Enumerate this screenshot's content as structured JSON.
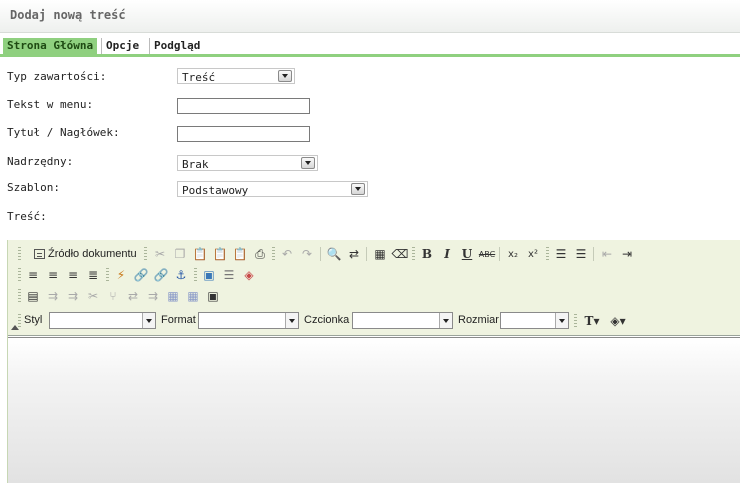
{
  "header": {
    "title": "Dodaj nową treść"
  },
  "tabs": [
    {
      "label": "Strona Główna",
      "active": true
    },
    {
      "label": "Opcje",
      "active": false
    },
    {
      "label": "Podgląd",
      "active": false
    }
  ],
  "form": {
    "content_type": {
      "label": "Typ zawartości:",
      "value": "Treść"
    },
    "menu_text": {
      "label": "Tekst w menu:",
      "value": ""
    },
    "title": {
      "label": "Tytuł / Nagłówek:",
      "value": ""
    },
    "parent": {
      "label": "Nadrzędny:",
      "value": "Brak"
    },
    "template": {
      "label": "Szablon:",
      "value": "Podstawowy"
    },
    "content": {
      "label": "Treść:"
    }
  },
  "editor": {
    "source_button": "Źródło dokumentu",
    "style_label": "Styl",
    "format_label": "Format",
    "font_label": "Czcionka",
    "size_label": "Rozmiar",
    "bold": "B",
    "italic": "I",
    "underline": "U",
    "strike": "ABC",
    "subscript": "x₂",
    "superscript": "x²"
  },
  "colors": {
    "tab_active": "#8fd07f",
    "toolbar_bg": "#eff3e0"
  }
}
